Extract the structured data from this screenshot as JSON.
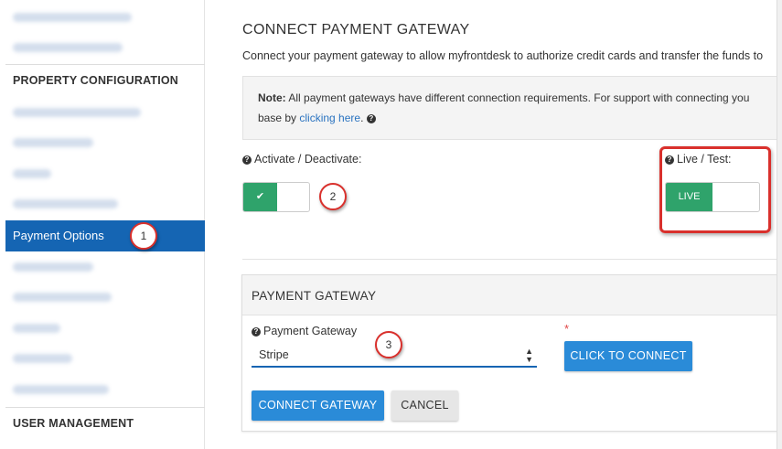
{
  "sidebar": {
    "section_property": "PROPERTY CONFIGURATION",
    "active_item": "Payment Options",
    "section_user": "USER MANAGEMENT"
  },
  "callouts": [
    "1",
    "2",
    "3"
  ],
  "main": {
    "title": "CONNECT PAYMENT GATEWAY",
    "description": "Connect your payment gateway to allow myfrontdesk to authorize credit cards and transfer the funds to",
    "note": {
      "label": "Note:",
      "text": "All payment gateways have different connection requirements. For support with connecting you",
      "text2": "base by",
      "link": "clicking here",
      "after_link": "."
    },
    "activate_label": "Activate / Deactivate:",
    "live_label": "Live / Test:",
    "live_button": "LIVE",
    "check_icon": "✔"
  },
  "panel": {
    "heading": "PAYMENT GATEWAY",
    "field_label": "Payment Gateway",
    "selected": "Stripe",
    "required_mark": "*",
    "connect_button": "CLICK TO CONNECT",
    "connect_gateway_button": "CONNECT GATEWAY",
    "cancel_button": "CANCEL"
  },
  "colors": {
    "active_blue": "#1565b3",
    "success_green": "#2fa36b",
    "primary_button": "#2a8bd8",
    "callout_red": "#d9302c"
  }
}
